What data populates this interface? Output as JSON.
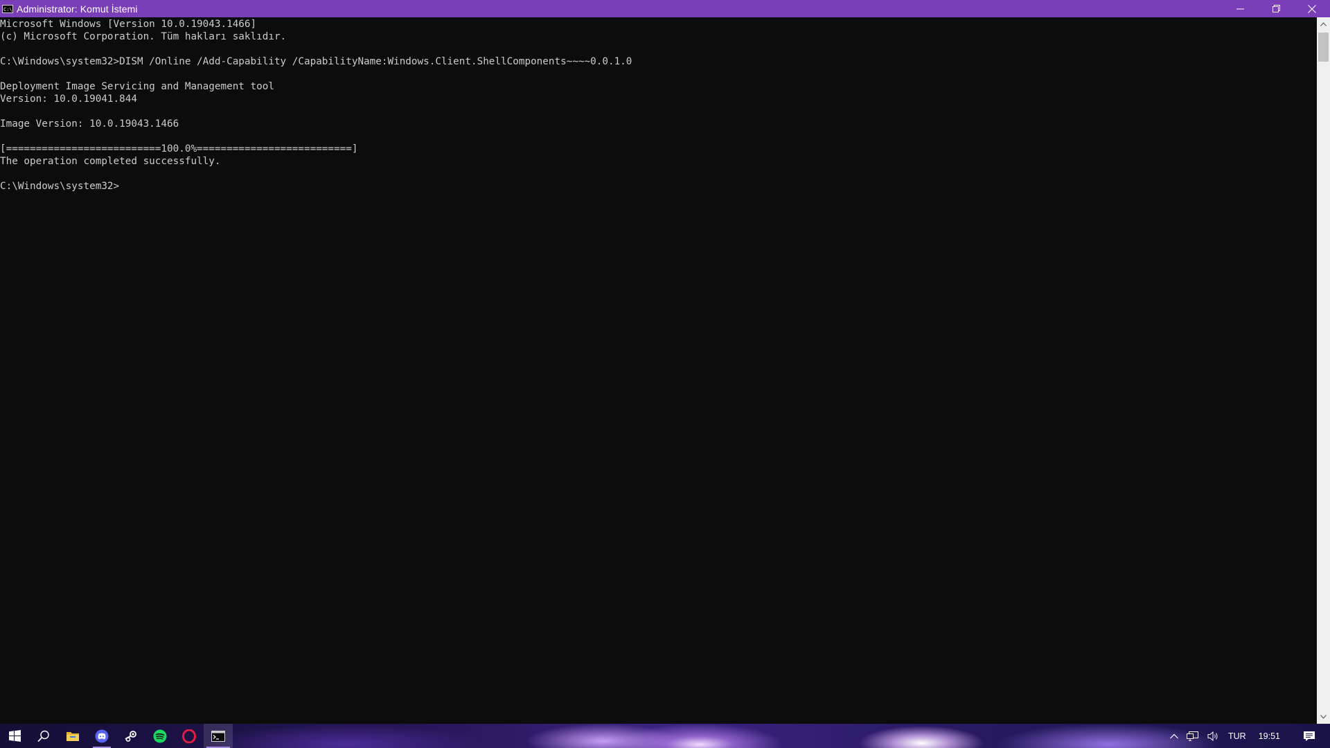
{
  "window": {
    "title": "Administrator: Komut İstemi",
    "icon_label": "C:\\"
  },
  "console": {
    "lines": [
      "Microsoft Windows [Version 10.0.19043.1466]",
      "(c) Microsoft Corporation. Tüm hakları saklıdır.",
      "",
      "C:\\Windows\\system32>DISM /Online /Add-Capability /CapabilityName:Windows.Client.ShellComponents~~~~0.0.1.0",
      "",
      "Deployment Image Servicing and Management tool",
      "Version: 10.0.19041.844",
      "",
      "Image Version: 10.0.19043.1466",
      "",
      "[==========================100.0%==========================]",
      "The operation completed successfully.",
      "",
      "C:\\Windows\\system32>"
    ]
  },
  "taskbar": {
    "apps": [
      {
        "name": "start-button",
        "icon": "windows-logo-icon"
      },
      {
        "name": "search-button",
        "icon": "search-icon"
      },
      {
        "name": "file-explorer-button",
        "icon": "folder-icon"
      },
      {
        "name": "discord-button",
        "icon": "discord-icon"
      },
      {
        "name": "steam-button",
        "icon": "steam-icon"
      },
      {
        "name": "spotify-button",
        "icon": "spotify-icon"
      },
      {
        "name": "opera-button",
        "icon": "opera-icon"
      },
      {
        "name": "command-prompt-button",
        "icon": "terminal-icon"
      }
    ],
    "tray": {
      "language": "TUR",
      "time": "19:51"
    }
  },
  "colors": {
    "titlebar": "#7a3fb8",
    "console_bg": "#0c0c0c",
    "console_text": "#cccccc"
  }
}
